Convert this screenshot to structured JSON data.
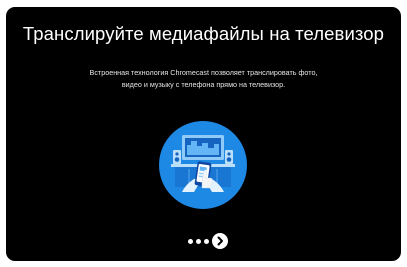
{
  "onboarding": {
    "title": "Транслируйте медиафайлы на телевизор",
    "description_line1": "Встроенная технология Chromecast позволяет транслировать фото,",
    "description_line2": "видео и музыку с телефона прямо на телевизор.",
    "illustration_icon": "cast-media-to-tv-illustration"
  },
  "pager": {
    "dot_count": 3,
    "next_icon": "chevron-right-icon"
  },
  "colors": {
    "background": "#000000",
    "illustration_circle": "#1e88e5",
    "illustration_light": "#bbdefb",
    "text": "#ffffff"
  }
}
